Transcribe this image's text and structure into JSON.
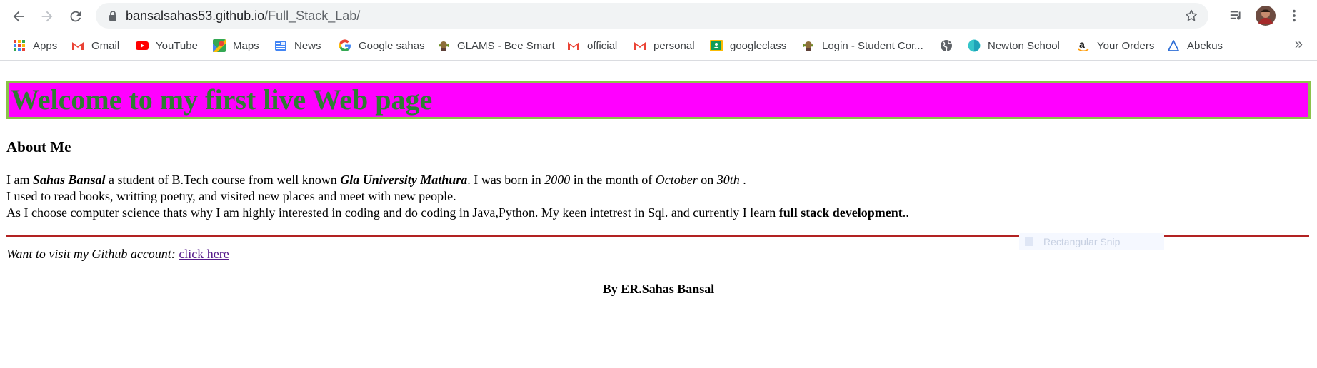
{
  "browser": {
    "url_host": "bansalsahas53.github.io",
    "url_path": "/Full_Stack_Lab/",
    "bookmarks": [
      {
        "label": "Apps",
        "icon": "apps-grid-icon"
      },
      {
        "label": "Gmail",
        "icon": "gmail-icon"
      },
      {
        "label": "YouTube",
        "icon": "youtube-icon"
      },
      {
        "label": "Maps",
        "icon": "maps-icon"
      },
      {
        "label": "News",
        "icon": "news-icon"
      },
      {
        "label": "Google sahas",
        "icon": "google-icon"
      },
      {
        "label": "GLAMS - Bee Smart",
        "icon": "glams-icon"
      },
      {
        "label": "official",
        "icon": "gmail-icon"
      },
      {
        "label": "personal",
        "icon": "gmail-icon"
      },
      {
        "label": "googleclass",
        "icon": "classroom-icon"
      },
      {
        "label": "Login - Student Cor...",
        "icon": "glams-icon"
      },
      {
        "label": "",
        "icon": "globe-icon"
      },
      {
        "label": "Newton School",
        "icon": "newton-icon"
      },
      {
        "label": "Your Orders",
        "icon": "amazon-icon"
      },
      {
        "label": "Abekus",
        "icon": "abekus-icon"
      }
    ],
    "more_label": "»"
  },
  "page": {
    "heading": "Welcome to my first live Web page",
    "about_heading": "About Me",
    "line1": {
      "t1": "I am ",
      "name": "Sahas Bansal",
      "t2": " a student of B.Tech course from well known ",
      "university": "Gla University Mathura",
      "t3": ". I was born in ",
      "year": "2000",
      "t4": " in the month of ",
      "month": "October",
      "t5": " on ",
      "day": "30th",
      "t6": " ."
    },
    "line2": "I used to read books, writting poetry, and visited new places and meet with new people.",
    "line3": {
      "t1": "As I choose computer science thats why I am highly interested in coding and do coding in Java,Python. My keen intetrest in Sql. and currently I learn ",
      "bold": "full stack development",
      "t2": ".."
    },
    "github_prompt": "Want to visit my Github account: ",
    "github_link": "click here",
    "byline": "By ER.Sahas Bansal",
    "overlay_label": "Rectangular Snip"
  },
  "colors": {
    "banner_bg": "#ff00ff",
    "banner_border": "#8bc34a",
    "heading_text": "#2e7d32",
    "rule": "#b22222",
    "link": "#551a8b"
  }
}
